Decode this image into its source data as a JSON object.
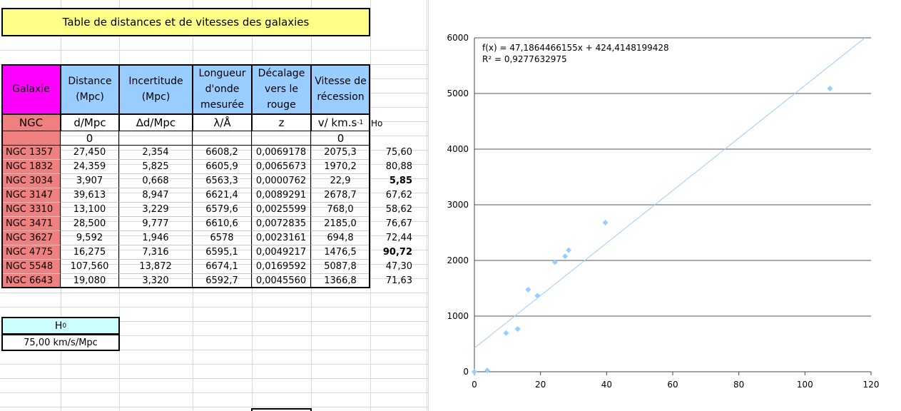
{
  "title": "Table de distances et de vitesses des galaxies",
  "headers": {
    "galaxie": "Galaxie",
    "distance": [
      "Distance",
      "(Mpc)"
    ],
    "incertitude": [
      "Incertitude",
      "(Mpc)"
    ],
    "longueur": [
      "Longueur",
      "d'onde",
      "mesurée"
    ],
    "decalage": [
      "Décalage",
      "vers le",
      "rouge"
    ],
    "vitesse": [
      "Vitesse de",
      "récession"
    ]
  },
  "symbols": {
    "ngc": "NGC",
    "d": "d/Mpc",
    "dd": "∆d/Mpc",
    "lambda": "λ/Å",
    "z": "z",
    "v": "v/ km.s",
    "v_sup": "-1",
    "ho": "Ho"
  },
  "zeros": {
    "distance": "0",
    "vitesse": "0"
  },
  "rows": [
    {
      "name": "NGC 1357",
      "d": "27,450",
      "dd": "2,354",
      "lambda": "6608,2",
      "z": "0,0069178",
      "v": "2075,3",
      "ho": "75,60",
      "ho_bold": false
    },
    {
      "name": "NGC 1832",
      "d": "24,359",
      "dd": "5,825",
      "lambda": "6605,9",
      "z": "0,0065673",
      "v": "1970,2",
      "ho": "80,88",
      "ho_bold": false
    },
    {
      "name": "NGC 3034",
      "d": "3,907",
      "dd": "0,668",
      "lambda": "6563,3",
      "z": "0,0000762",
      "v": "22,9",
      "ho": "5,85",
      "ho_bold": true
    },
    {
      "name": "NGC 3147",
      "d": "39,613",
      "dd": "8,947",
      "lambda": "6621,4",
      "z": "0,0089291",
      "v": "2678,7",
      "ho": "67,62",
      "ho_bold": false
    },
    {
      "name": "NGC 3310",
      "d": "13,100",
      "dd": "3,229",
      "lambda": "6579,6",
      "z": "0,0025599",
      "v": "768,0",
      "ho": "58,62",
      "ho_bold": false
    },
    {
      "name": "NGC 3471",
      "d": "28,500",
      "dd": "9,777",
      "lambda": "6610,6",
      "z": "0,0072835",
      "v": "2185,0",
      "ho": "76,67",
      "ho_bold": false
    },
    {
      "name": "NGC 3627",
      "d": "9,592",
      "dd": "1,946",
      "lambda": "6578",
      "z": "0,0023161",
      "v": "694,8",
      "ho": "72,44",
      "ho_bold": false
    },
    {
      "name": "NGC 4775",
      "d": "16,275",
      "dd": "7,316",
      "lambda": "6595,1",
      "z": "0,0049217",
      "v": "1476,5",
      "ho": "90,72",
      "ho_bold": true
    },
    {
      "name": "NGC 5548",
      "d": "107,560",
      "dd": "13,872",
      "lambda": "6674,1",
      "z": "0,0169592",
      "v": "5087,8",
      "ho": "47,30",
      "ho_bold": false
    },
    {
      "name": "NGC 6643",
      "d": "19,080",
      "dd": "3,320",
      "lambda": "6592,7",
      "z": "0,0045560",
      "v": "1366,8",
      "ho": "71,63",
      "ho_bold": false
    }
  ],
  "h0": {
    "label": "H",
    "sub": "0",
    "value": "75,00 km/s/Mpc"
  },
  "colors": {
    "title_bg": "#ffff88",
    "galaxie_bg": "#ff00ff",
    "header_blue": "#99ccff",
    "ngc_bg": "#f08080",
    "h0_bg": "#ccffff",
    "marker": "#99ccff",
    "trend": "#99ccff"
  },
  "chart_data": {
    "type": "scatter",
    "xlim": [
      0,
      120
    ],
    "ylim": [
      0,
      6000
    ],
    "xticks": [
      0,
      20,
      40,
      60,
      80,
      100,
      120
    ],
    "yticks": [
      0,
      1000,
      2000,
      3000,
      4000,
      5000,
      6000
    ],
    "grid": "horizontal",
    "series": [
      {
        "points": [
          [
            0,
            0
          ],
          [
            27.45,
            2075.3
          ],
          [
            24.359,
            1970.2
          ],
          [
            3.907,
            22.9
          ],
          [
            39.613,
            2678.7
          ],
          [
            13.1,
            768.0
          ],
          [
            28.5,
            2185.0
          ],
          [
            9.592,
            694.8
          ],
          [
            16.275,
            1476.5
          ],
          [
            107.56,
            5087.8
          ],
          [
            19.08,
            1366.8
          ]
        ]
      }
    ],
    "trendline": {
      "slope": 47.1864466155,
      "intercept": 424.4148199428
    },
    "equation": "f(x) = 47,1864466155x + 424,4148199428",
    "r2": "R² = 0,9277632975"
  }
}
